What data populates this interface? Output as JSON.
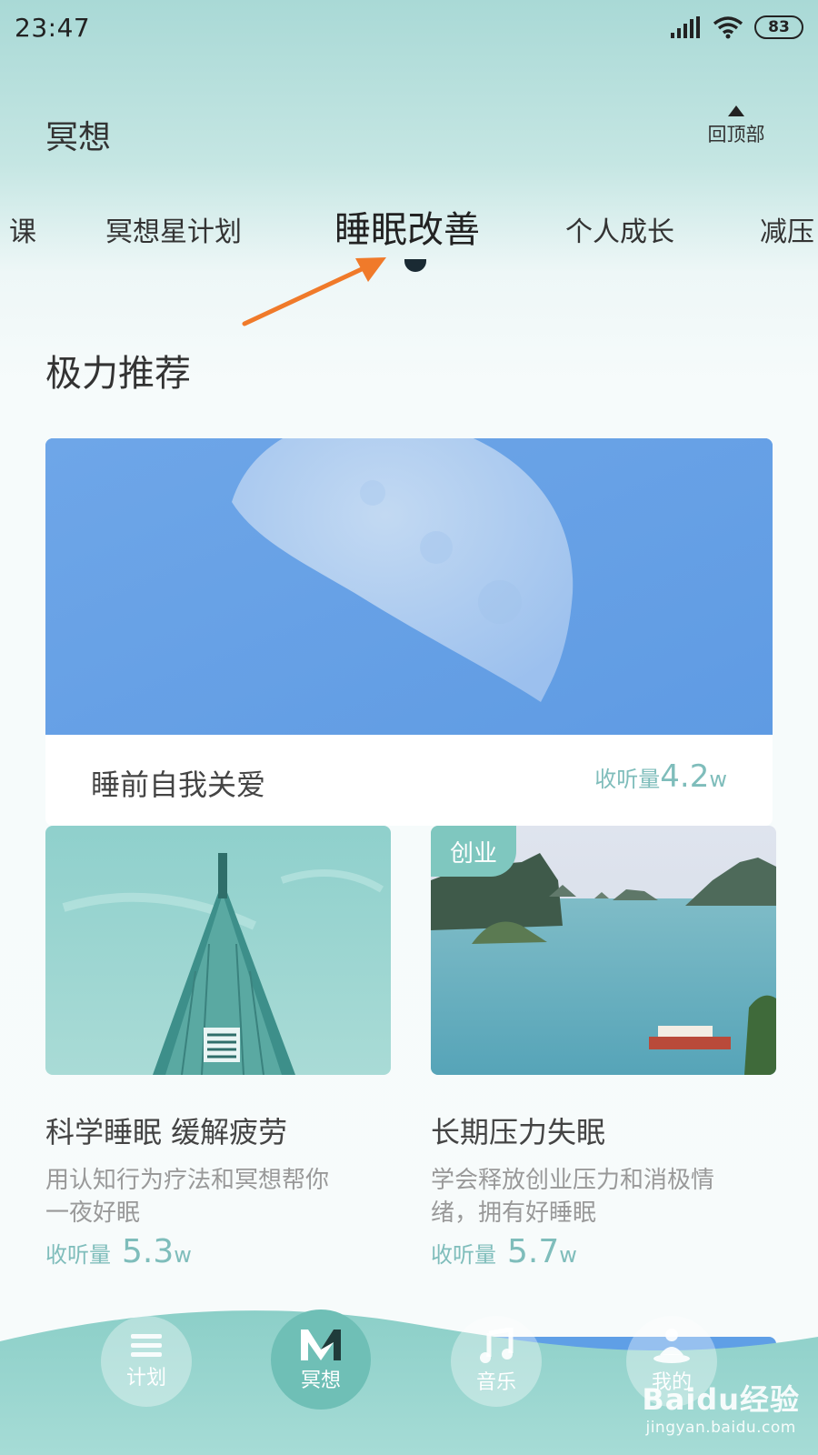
{
  "status_bar": {
    "time": "23:47",
    "battery": "83"
  },
  "header": {
    "title": "冥想",
    "back_to_top": "回顶部"
  },
  "tabs": [
    {
      "label": "课"
    },
    {
      "label": "冥想星计划"
    },
    {
      "label": "睡眠改善"
    },
    {
      "label": "个人成长"
    },
    {
      "label": "减压"
    }
  ],
  "section": {
    "title": "极力推荐"
  },
  "featured": {
    "title": "睡前自我关爱",
    "listen_label": "收听量",
    "listen_value": "4.2",
    "listen_unit": "w"
  },
  "cards": [
    {
      "title": "科学睡眠 缓解疲劳",
      "desc_line1": "用认知行为疗法和冥想帮你",
      "desc_line2": "一夜好眠",
      "listen_label": "收听量",
      "listen_value": "5.3",
      "listen_unit": "w"
    },
    {
      "badge": "创业",
      "title": "长期压力失眠",
      "desc_line1": "学会释放创业压力和消极情",
      "desc_line2": "绪，拥有好睡眠",
      "listen_label": "收听量",
      "listen_value": "5.7",
      "listen_unit": "w"
    }
  ],
  "bottom_nav": [
    {
      "label": "计划",
      "icon": "menu-icon"
    },
    {
      "label": "冥想",
      "icon": "m-logo-icon"
    },
    {
      "label": "音乐",
      "icon": "music-note-icon"
    },
    {
      "label": "我的",
      "icon": "meditating-person-icon"
    }
  ],
  "watermark": {
    "logo": "Baidu经验",
    "url": "jingyan.baidu.com"
  },
  "colors": {
    "accent": "#7fbdbb",
    "nav_active": "#6fbfb6",
    "badge": "#7fc7bf"
  }
}
